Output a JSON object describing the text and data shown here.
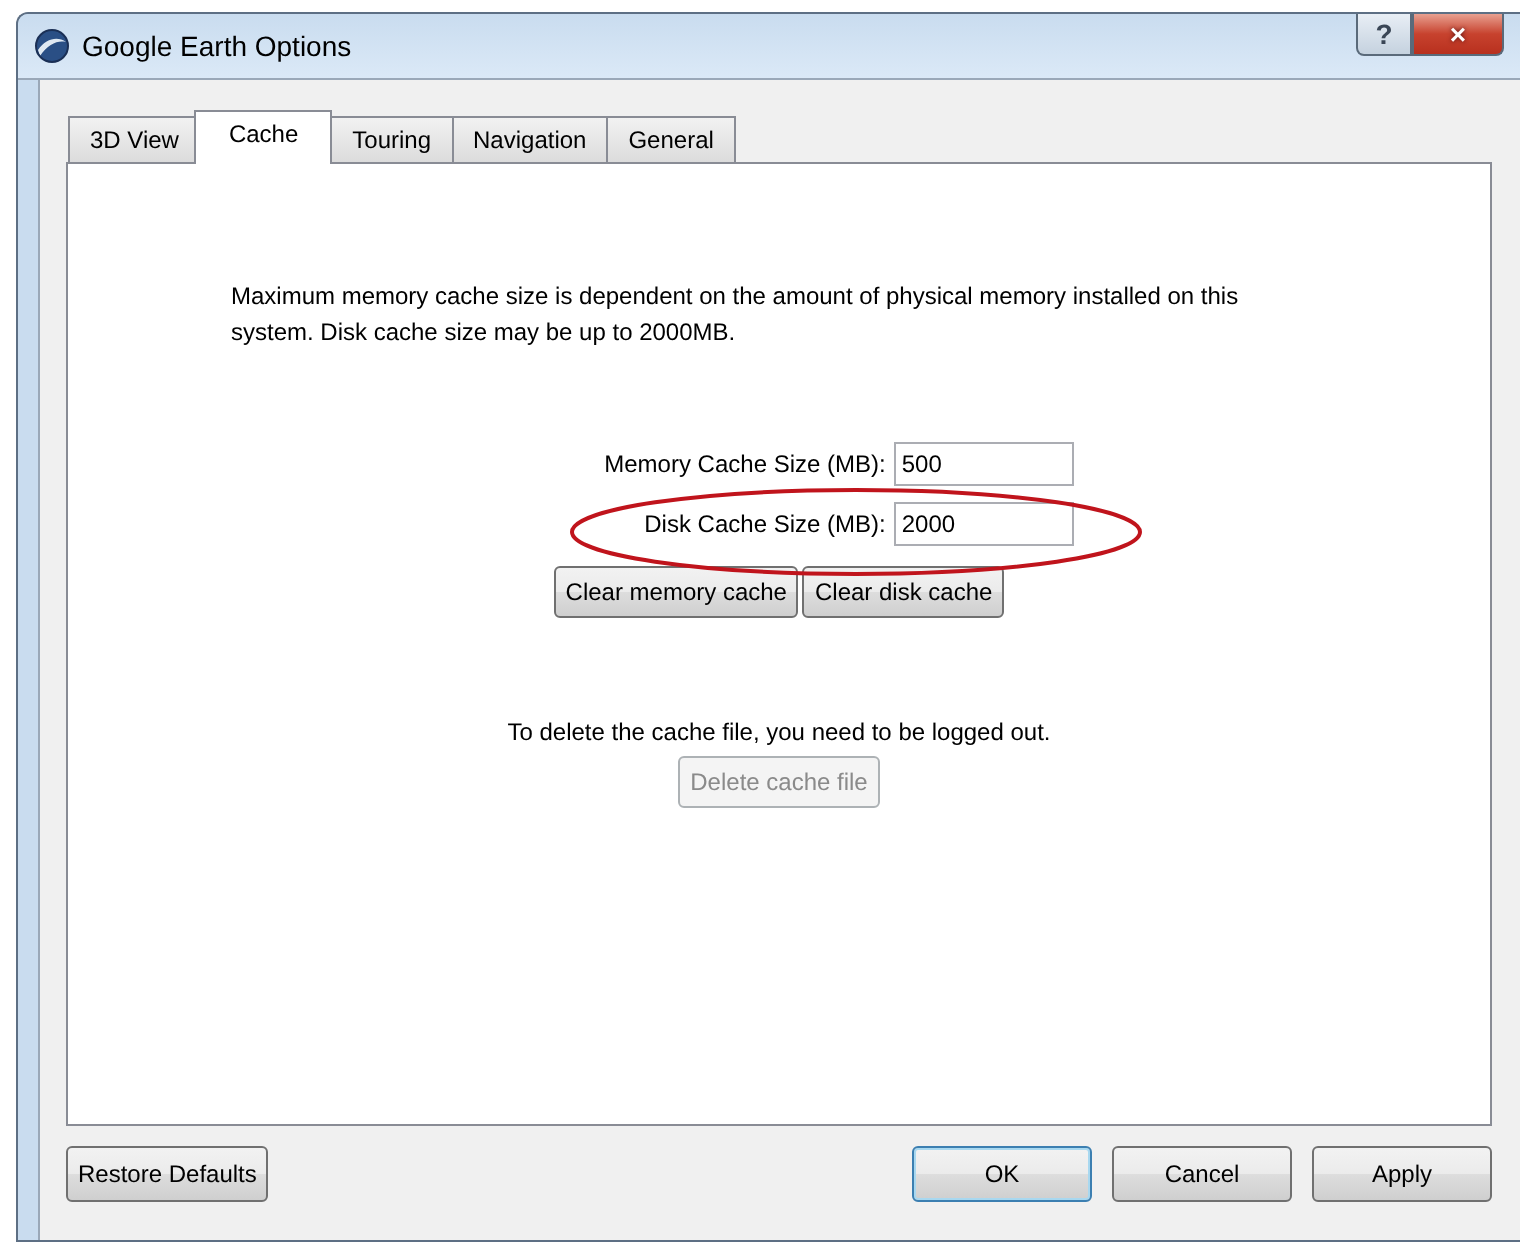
{
  "window": {
    "title": "Google Earth Options",
    "buttons": [
      {
        "kind": "help",
        "label": "?"
      },
      {
        "kind": "close",
        "label": "×"
      }
    ]
  },
  "tabs": [
    {
      "label": "3D View",
      "selected": false
    },
    {
      "label": "Cache",
      "selected": true
    },
    {
      "label": "Touring",
      "selected": false
    },
    {
      "label": "Navigation",
      "selected": false
    },
    {
      "label": "General",
      "selected": false
    }
  ],
  "info_text": "Maximum memory cache size is dependent on the amount of physical memory installed on this system. Disk cache size may be up to 2000MB.",
  "fields": [
    {
      "label": "Memory Cache Size (MB):",
      "value": "500",
      "highlighted": false
    },
    {
      "label": "Disk Cache Size (MB):",
      "value": "2000",
      "highlighted": true
    }
  ],
  "clear_buttons": [
    {
      "label": "Clear memory cache",
      "disabled": false
    },
    {
      "label": "Clear disk cache",
      "disabled": false
    }
  ],
  "delete_note": "To delete the cache file, you need to be logged out.",
  "delete_button": {
    "label": "Delete cache file",
    "disabled": true
  },
  "footer": {
    "restore_button": "Restore Defaults",
    "buttons": [
      {
        "label": "OK",
        "default": true
      },
      {
        "label": "Cancel",
        "default": false
      },
      {
        "label": "Apply",
        "default": false
      }
    ]
  }
}
